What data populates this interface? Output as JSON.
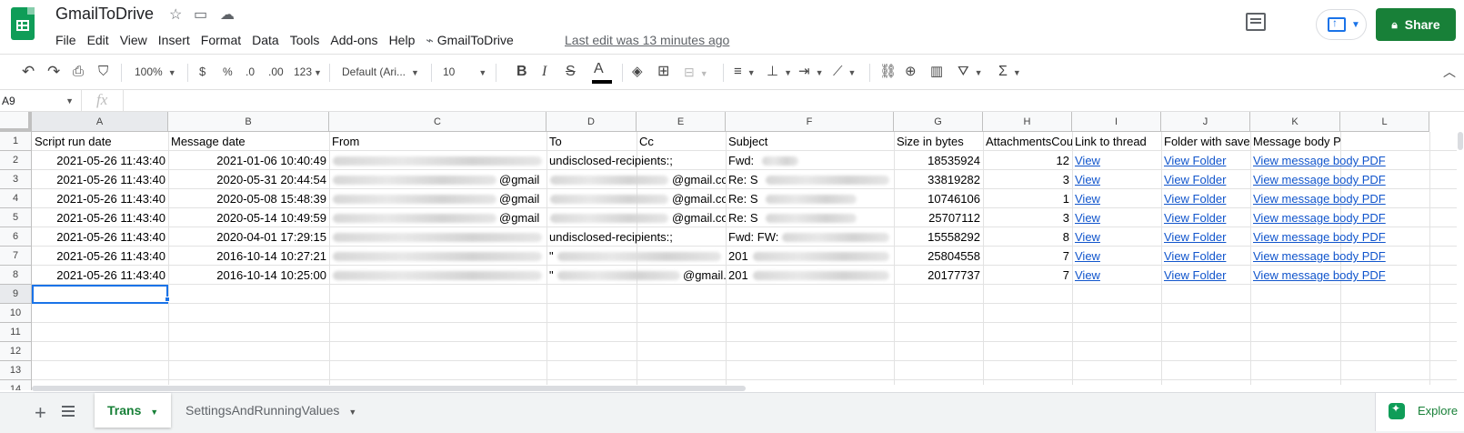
{
  "app": {
    "doc_title": "GmailToDrive",
    "last_edit": "Last edit was 13 minutes ago",
    "share_label": "Share",
    "menu": [
      "File",
      "Edit",
      "View",
      "Insert",
      "Format",
      "Data",
      "Tools",
      "Add-ons",
      "Help",
      "GmailToDrive"
    ]
  },
  "toolbar": {
    "zoom": "100%",
    "currency": "$",
    "percent": "%",
    "dec_less": ".0",
    "dec_more": ".00",
    "more_formats": "123",
    "font": "Default (Ari...",
    "font_size": "10",
    "bold": "B",
    "italic": "I",
    "strike": "S",
    "text_color": "A",
    "functions": "Σ"
  },
  "formula_bar": {
    "name_box": "A9",
    "fx": "fx",
    "value": ""
  },
  "grid": {
    "columns": [
      "A",
      "B",
      "C",
      "D",
      "E",
      "F",
      "G",
      "H",
      "I",
      "J",
      "K",
      "L"
    ],
    "row_numbers": [
      "1",
      "2",
      "3",
      "4",
      "5",
      "6",
      "7",
      "8",
      "9",
      "10",
      "11",
      "12",
      "13",
      "14"
    ],
    "header_row": [
      "Script run date",
      "Message date",
      "From",
      "To",
      "Cc",
      "Subject",
      "Size in bytes",
      "AttachmentsCou",
      "Link to thread",
      "Folder with save",
      "Message body PDF"
    ],
    "rows": [
      {
        "script_run": "2021-05-26 11:43:40",
        "msg_date": "2021-01-06 10:40:49",
        "to": "undisclosed-recipients:;",
        "subject": "Fwd:",
        "size": "18535924",
        "attachments": "12",
        "link": "View",
        "folder": "View Folder",
        "pdf": "View message body PDF"
      },
      {
        "script_run": "2021-05-26 11:43:40",
        "msg_date": "2020-05-31 20:44:54",
        "from_suffix": "@gmail",
        "to": "",
        "to_suffix": "@gmail.co",
        "subject": "Re: S",
        "size": "33819282",
        "attachments": "3",
        "link": "View",
        "folder": "View Folder",
        "pdf": "View message body PDF"
      },
      {
        "script_run": "2021-05-26 11:43:40",
        "msg_date": "2020-05-08 15:48:39",
        "from_suffix": "@gmail",
        "to": "",
        "to_suffix": "@gmail.co",
        "subject": "Re: S",
        "size": "10746106",
        "attachments": "1",
        "link": "View",
        "folder": "View Folder",
        "pdf": "View message body PDF"
      },
      {
        "script_run": "2021-05-26 11:43:40",
        "msg_date": "2020-05-14 10:49:59",
        "from_suffix": "@gmail",
        "to": "",
        "to_suffix": "@gmail.co",
        "subject": "Re: S",
        "size": "25707112",
        "attachments": "3",
        "link": "View",
        "folder": "View Folder",
        "pdf": "View message body PDF"
      },
      {
        "script_run": "2021-05-26 11:43:40",
        "msg_date": "2020-04-01 17:29:15",
        "to": "undisclosed-recipients:;",
        "subject": "Fwd: FW:",
        "size": "15558292",
        "attachments": "8",
        "link": "View",
        "folder": "View Folder",
        "pdf": "View message body PDF"
      },
      {
        "script_run": "2021-05-26 11:43:40",
        "msg_date": "2016-10-14 10:27:21",
        "to": "\"",
        "to_suffix": "",
        "subject": "201",
        "size": "25804558",
        "attachments": "7",
        "link": "View",
        "folder": "View Folder",
        "pdf": "View message body PDF"
      },
      {
        "script_run": "2021-05-26 11:43:40",
        "msg_date": "2016-10-14 10:25:00",
        "to": "\"",
        "to_suffix": "@gmail.",
        "subject": "201",
        "size": "20177737",
        "attachments": "7",
        "link": "View",
        "folder": "View Folder",
        "pdf": "View message body PDF"
      }
    ]
  },
  "sheets": {
    "tabs": [
      {
        "label": "Trans",
        "active": true
      },
      {
        "label": "SettingsAndRunningValues",
        "active": false
      }
    ],
    "explore_label": "Explore"
  },
  "colors": {
    "brand_green": "#0f9d58",
    "share_green": "#188038",
    "link_blue": "#1155cc",
    "selection_blue": "#1a73e8"
  },
  "icons": [
    "sheets-logo-icon",
    "star-icon",
    "move-folder-icon",
    "cloud-status-icon",
    "comments-icon",
    "present-icon",
    "lock-icon",
    "undo-icon",
    "redo-icon",
    "print-icon",
    "paint-format-icon",
    "fill-color-icon",
    "borders-icon",
    "merge-icon",
    "align-icon",
    "valign-icon",
    "wrap-icon",
    "rotate-icon",
    "link-icon",
    "comment-icon",
    "chart-icon",
    "filter-icon",
    "functions-icon",
    "add-sheet-icon",
    "all-sheets-icon",
    "explore-icon"
  ]
}
